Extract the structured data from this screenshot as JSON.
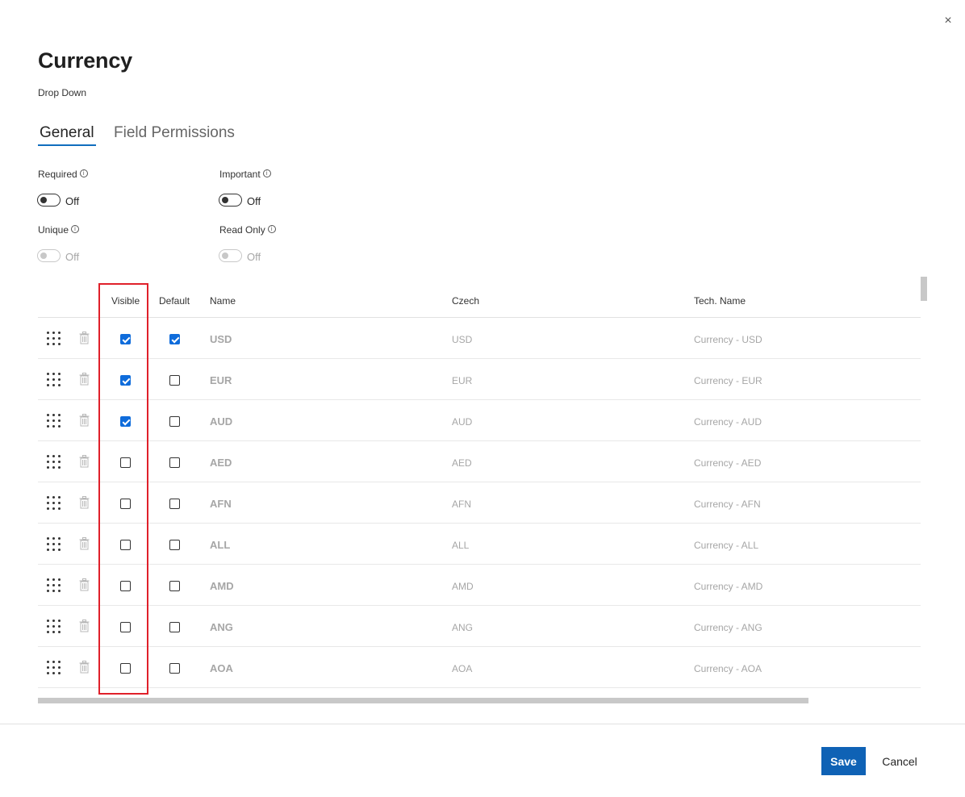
{
  "dialog": {
    "title": "Currency",
    "subtitle": "Drop Down",
    "close_label": "×"
  },
  "tabs": [
    {
      "label": "General",
      "active": true
    },
    {
      "label": "Field Permissions",
      "active": false
    }
  ],
  "options": {
    "required": {
      "label": "Required",
      "state": "Off",
      "enabled": true
    },
    "important": {
      "label": "Important",
      "state": "Off",
      "enabled": true
    },
    "unique": {
      "label": "Unique",
      "state": "Off",
      "enabled": false
    },
    "read_only": {
      "label": "Read Only",
      "state": "Off",
      "enabled": false
    }
  },
  "table": {
    "columns": [
      "Visible",
      "Default",
      "Name",
      "Czech",
      "Tech. Name"
    ],
    "rows": [
      {
        "visible": true,
        "default": true,
        "name": "USD",
        "czech": "USD",
        "tech_name": "Currency - USD"
      },
      {
        "visible": true,
        "default": false,
        "name": "EUR",
        "czech": "EUR",
        "tech_name": "Currency - EUR"
      },
      {
        "visible": true,
        "default": false,
        "name": "AUD",
        "czech": "AUD",
        "tech_name": "Currency - AUD"
      },
      {
        "visible": false,
        "default": false,
        "name": "AED",
        "czech": "AED",
        "tech_name": "Currency - AED"
      },
      {
        "visible": false,
        "default": false,
        "name": "AFN",
        "czech": "AFN",
        "tech_name": "Currency - AFN"
      },
      {
        "visible": false,
        "default": false,
        "name": "ALL",
        "czech": "ALL",
        "tech_name": "Currency - ALL"
      },
      {
        "visible": false,
        "default": false,
        "name": "AMD",
        "czech": "AMD",
        "tech_name": "Currency - AMD"
      },
      {
        "visible": false,
        "default": false,
        "name": "ANG",
        "czech": "ANG",
        "tech_name": "Currency - ANG"
      },
      {
        "visible": false,
        "default": false,
        "name": "AOA",
        "czech": "AOA",
        "tech_name": "Currency - AOA"
      }
    ]
  },
  "footer": {
    "save_label": "Save",
    "cancel_label": "Cancel"
  },
  "colors": {
    "accent": "#0f62b5",
    "checkbox_checked": "#0f6cdb",
    "highlight_border": "#e0202a",
    "muted_text": "#a6a6a6"
  }
}
